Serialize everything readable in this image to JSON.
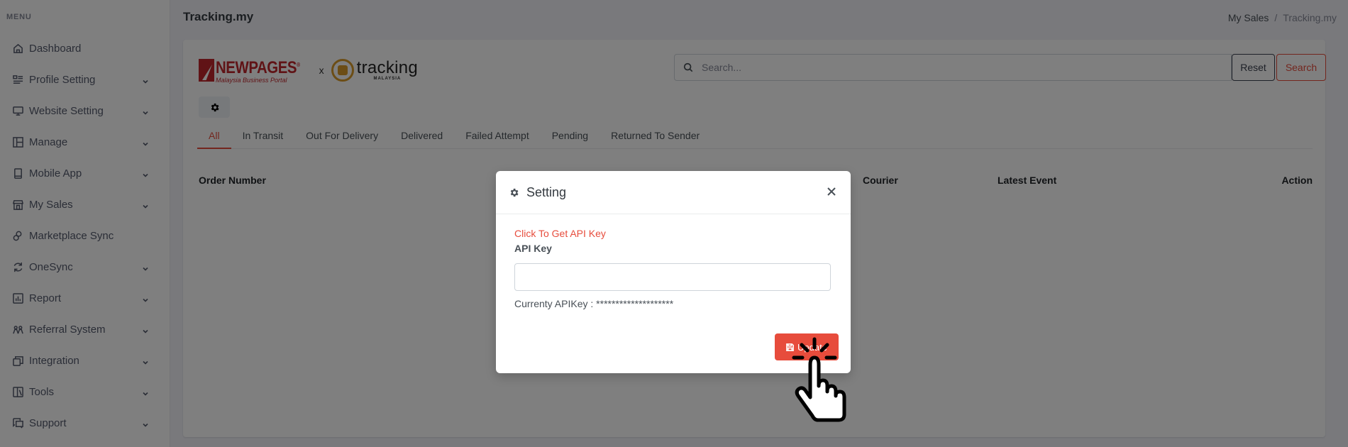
{
  "sidebar": {
    "menu_title": "MENU",
    "items": [
      {
        "label": "Dashboard",
        "icon": "home-icon",
        "has_children": false
      },
      {
        "label": "Profile Setting",
        "icon": "profile-list-icon",
        "has_children": true
      },
      {
        "label": "Website Setting",
        "icon": "monitor-icon",
        "has_children": true
      },
      {
        "label": "Manage",
        "icon": "layout-icon",
        "has_children": true
      },
      {
        "label": "Mobile App",
        "icon": "mobile-icon",
        "has_children": true
      },
      {
        "label": "My Sales",
        "icon": "store-icon",
        "has_children": true
      },
      {
        "label": "Marketplace Sync",
        "icon": "cloud-sync-icon",
        "has_children": false
      },
      {
        "label": "OneSync",
        "icon": "refresh-icon",
        "has_children": true
      },
      {
        "label": "Report",
        "icon": "bar-chart-icon",
        "has_children": true
      },
      {
        "label": "Referral System",
        "icon": "users-icon",
        "has_children": true
      },
      {
        "label": "Integration",
        "icon": "stack-icon",
        "has_children": true
      },
      {
        "label": "Tools",
        "icon": "tools-icon",
        "has_children": true
      },
      {
        "label": "Support",
        "icon": "chat-icon",
        "has_children": true
      }
    ]
  },
  "header": {
    "title": "Tracking.my",
    "breadcrumb": [
      "My Sales",
      "Tracking.my"
    ],
    "breadcrumb_sep": "/"
  },
  "logos": {
    "newpages_name": "NEWPAGES",
    "newpages_reg": "®",
    "newpages_tagline": "Malaysia Business Portal",
    "separator": "x",
    "tracking_name": "tracking",
    "tracking_sub": "MALAYSIA"
  },
  "search": {
    "placeholder": "Search...",
    "value": "",
    "reset_label": "Reset",
    "search_label": "Search"
  },
  "tabs": [
    {
      "label": "All",
      "active": true
    },
    {
      "label": "In Transit",
      "active": false
    },
    {
      "label": "Out For Delivery",
      "active": false
    },
    {
      "label": "Delivered",
      "active": false
    },
    {
      "label": "Failed Attempt",
      "active": false
    },
    {
      "label": "Pending",
      "active": false
    },
    {
      "label": "Returned To Sender",
      "active": false
    }
  ],
  "table": {
    "columns": [
      "Order Number",
      "Courier",
      "Latest Event",
      "Action"
    ]
  },
  "modal": {
    "title": "Setting",
    "api_link": "Click To Get API Key",
    "api_label": "API Key",
    "api_value": "",
    "current_key_label": "Currenty APIKey : ",
    "current_key_value": "********************",
    "update_label": "Update"
  },
  "colors": {
    "accent": "#e74c3c",
    "overlay": "rgba(0,0,0,0.5)"
  }
}
